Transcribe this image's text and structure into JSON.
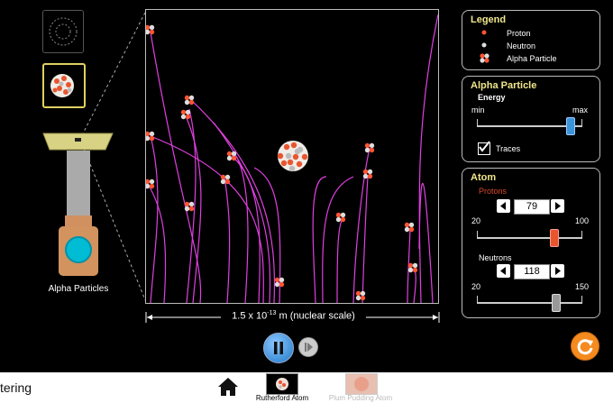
{
  "gun": {
    "label": "Alpha Particles"
  },
  "scale": {
    "label_prefix": "1.5 x 10",
    "label_exp": "-13",
    "label_suffix": " m (nuclear scale)"
  },
  "legend": {
    "title": "Legend",
    "items": [
      {
        "label": "Proton",
        "icon": "proton-dot-icon"
      },
      {
        "label": "Neutron",
        "icon": "neutron-dot-icon"
      },
      {
        "label": "Alpha Particle",
        "icon": "alpha-particle-icon"
      }
    ]
  },
  "alpha": {
    "title": "Alpha Particle",
    "energy_label": "Energy",
    "min_label": "min",
    "max_label": "max",
    "energy_level": 0.88,
    "traces_label": "Traces",
    "traces_checked": true
  },
  "atom": {
    "title": "Atom",
    "protons_label": "Protons",
    "protons_value": "79",
    "protons_min": "20",
    "protons_max": "100",
    "neutrons_label": "Neutrons",
    "neutrons_value": "118",
    "neutrons_min": "20",
    "neutrons_max": "150"
  },
  "nav": {
    "title_partial": "tering",
    "screens": [
      {
        "label": "Rutherford Atom",
        "active": true
      },
      {
        "label": "Plum Pudding Atom",
        "active": false
      }
    ]
  },
  "colors": {
    "accent": "#f0e68c",
    "trace": "#e040e0",
    "proton": "#ff5533",
    "neutron": "#dddddd",
    "reset": "#f58a1f",
    "play": "#3d8fd8"
  }
}
